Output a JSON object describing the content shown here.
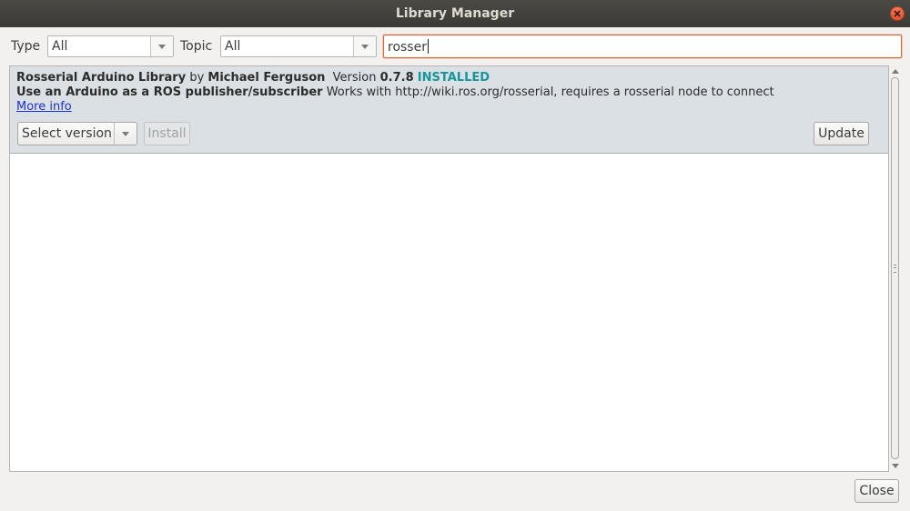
{
  "window": {
    "title": "Library Manager"
  },
  "filters": {
    "type_label": "Type",
    "type_value": "All",
    "topic_label": "Topic",
    "topic_value": "All",
    "search_value": "rosser"
  },
  "library": {
    "name": "Rosserial Arduino Library",
    "by_label": "by",
    "author": "Michael Ferguson",
    "version_label": "Version",
    "version": "0.7.8",
    "status": "INSTALLED",
    "sentence": "Use an Arduino as a ROS publisher/subscriber",
    "paragraph": "Works with http://wiki.ros.org/rosserial, requires a rosserial node to connect",
    "more_info": "More info",
    "select_version": "Select version",
    "install_label": "Install",
    "update_label": "Update"
  },
  "footer": {
    "close_label": "Close"
  },
  "colors": {
    "installed": "#17959a",
    "search_border": "#e0632f",
    "link": "#1a32cf"
  }
}
